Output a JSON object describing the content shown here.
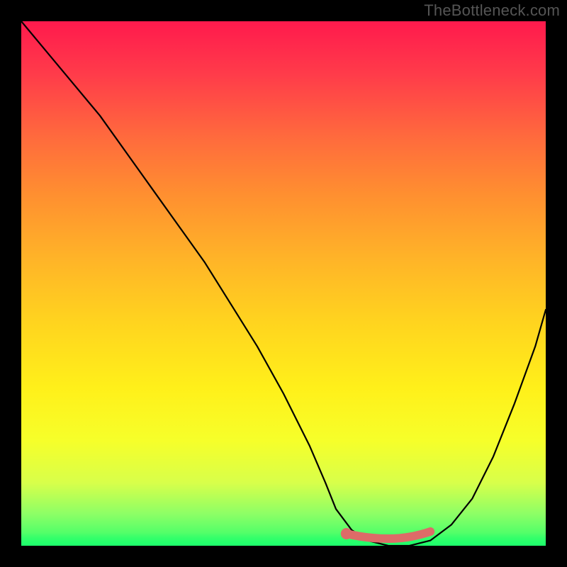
{
  "watermark": "TheBottleneck.com",
  "colors": {
    "frame_bg": "#000000",
    "curve": "#000000",
    "optimal_marker": "#dd6b68",
    "gradient_top": "#ff1a4d",
    "gradient_bottom": "#2bff6b"
  },
  "chart_data": {
    "type": "line",
    "title": "",
    "xlabel": "",
    "ylabel": "",
    "ylim": [
      0,
      100
    ],
    "xlim": [
      0,
      100
    ],
    "series": [
      {
        "name": "bottleneck-curve",
        "x": [
          0,
          5,
          10,
          15,
          20,
          25,
          30,
          35,
          40,
          45,
          50,
          55,
          58,
          60,
          63,
          66,
          70,
          74,
          78,
          82,
          86,
          90,
          94,
          98,
          100
        ],
        "values": [
          100,
          94,
          88,
          82,
          75,
          68,
          61,
          54,
          46,
          38,
          29,
          19,
          12,
          7,
          3,
          1,
          0,
          0,
          1,
          4,
          9,
          17,
          27,
          38,
          45
        ]
      }
    ],
    "optimal_range": {
      "x_start": 62,
      "x_end": 78,
      "y": 0
    },
    "annotations": []
  }
}
